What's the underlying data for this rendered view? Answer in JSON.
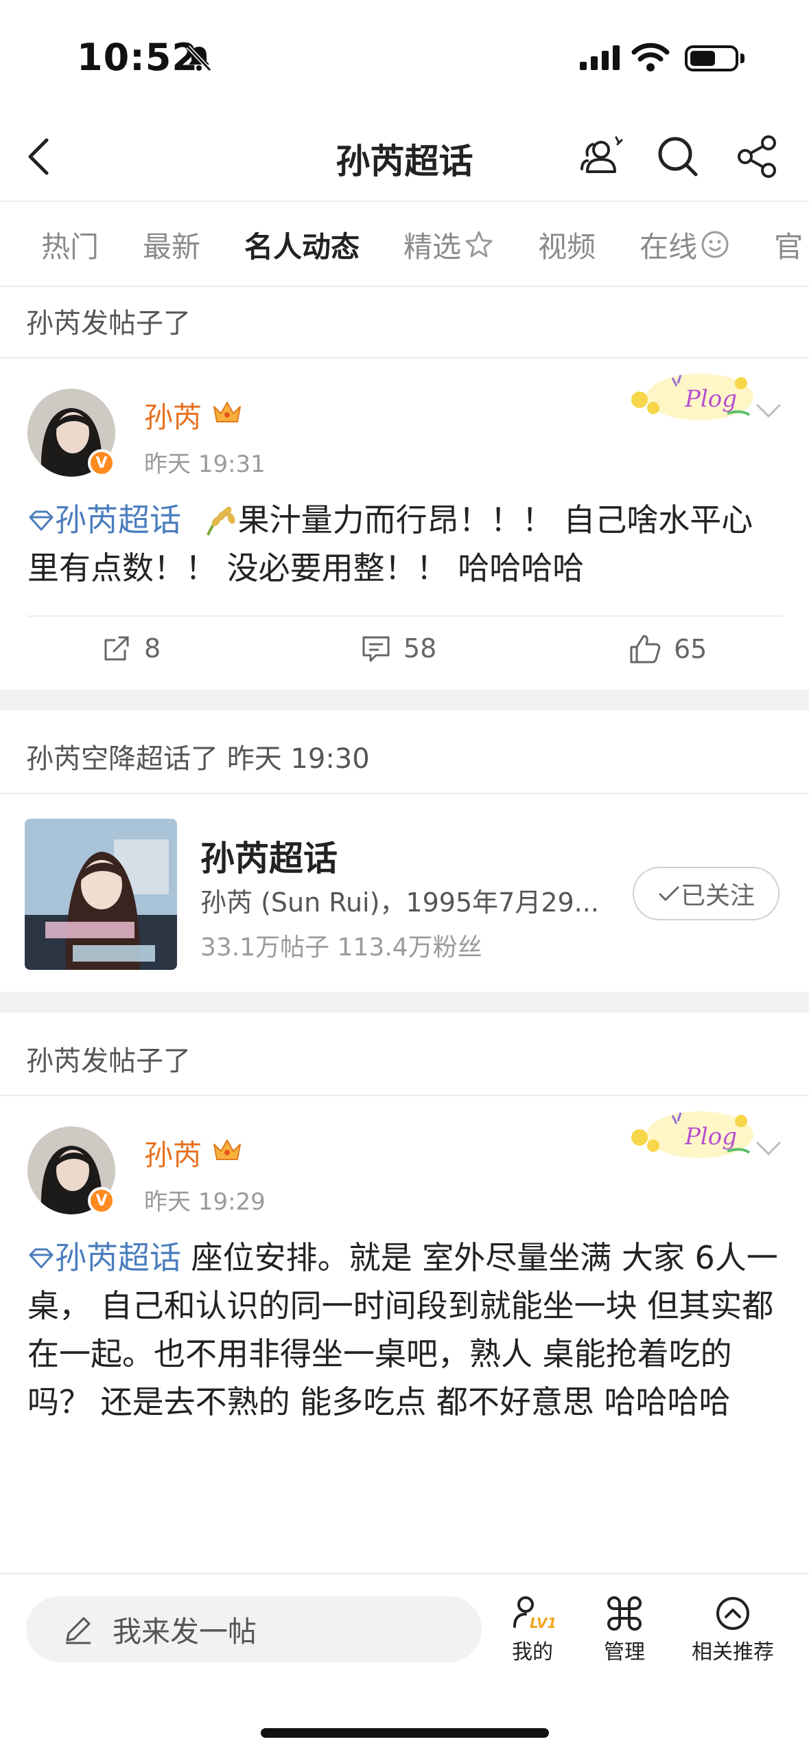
{
  "status_bar": {
    "time": "10:52"
  },
  "header": {
    "title": "孙芮超话"
  },
  "tabs": [
    {
      "label": "热门"
    },
    {
      "label": "最新"
    },
    {
      "label": "名人动态"
    },
    {
      "label": "精选"
    },
    {
      "label": "视频"
    },
    {
      "label": "在线"
    },
    {
      "label": "官"
    }
  ],
  "active_tab": "名人动态",
  "accent_color": "#ff6a1a",
  "feed": {
    "section1_title": "孙芮发帖子了",
    "post1": {
      "author": "孙芮",
      "time": "昨天 19:31",
      "topic": "孙芮超话",
      "text": "果汁量力而行昂！！！ 自己啥水平心里有点数！！ 没必要用整！！  哈哈哈哈",
      "reposts": "8",
      "comments": "58",
      "likes": "65"
    },
    "section2_title": "孙芮空降超话了 昨天 19:30",
    "topic_card": {
      "name": "孙芮超话",
      "desc": "孙芮 (Sun Rui)，1995年7月29...",
      "stats": "33.1万帖子  113.4万粉丝",
      "follow_label": "已关注"
    },
    "section3_title": "孙芮发帖子了",
    "post2": {
      "author": "孙芮",
      "time": "昨天 19:29",
      "topic": "孙芮超话",
      "text": " 座位安排。就是 室外尽量坐满 大家 6人一桌， 自己和认识的同一时间段到就能坐一块 但其实都在一起。也不用非得坐一桌吧，熟人 桌能抢着吃的吗？ 还是去不熟的 能多吃点 都不好意思 哈哈哈哈"
    }
  },
  "bottom_bar": {
    "compose_placeholder": "我来发一帖",
    "level_badge": "LV1",
    "nav": [
      {
        "label": "我的"
      },
      {
        "label": "管理"
      },
      {
        "label": "相关推荐"
      }
    ]
  }
}
